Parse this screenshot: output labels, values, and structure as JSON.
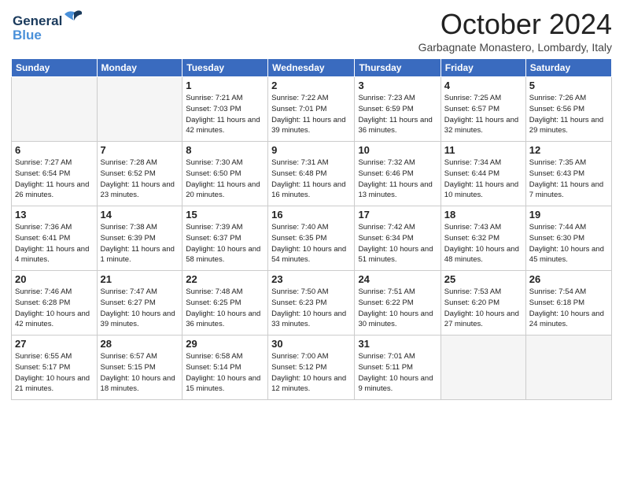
{
  "logo": {
    "line1": "General",
    "line2": "Blue"
  },
  "title": "October 2024",
  "subtitle": "Garbagnate Monastero, Lombardy, Italy",
  "days_of_week": [
    "Sunday",
    "Monday",
    "Tuesday",
    "Wednesday",
    "Thursday",
    "Friday",
    "Saturday"
  ],
  "weeks": [
    [
      {
        "day": "",
        "info": ""
      },
      {
        "day": "",
        "info": ""
      },
      {
        "day": "1",
        "info": "Sunrise: 7:21 AM\nSunset: 7:03 PM\nDaylight: 11 hours and 42 minutes."
      },
      {
        "day": "2",
        "info": "Sunrise: 7:22 AM\nSunset: 7:01 PM\nDaylight: 11 hours and 39 minutes."
      },
      {
        "day": "3",
        "info": "Sunrise: 7:23 AM\nSunset: 6:59 PM\nDaylight: 11 hours and 36 minutes."
      },
      {
        "day": "4",
        "info": "Sunrise: 7:25 AM\nSunset: 6:57 PM\nDaylight: 11 hours and 32 minutes."
      },
      {
        "day": "5",
        "info": "Sunrise: 7:26 AM\nSunset: 6:56 PM\nDaylight: 11 hours and 29 minutes."
      }
    ],
    [
      {
        "day": "6",
        "info": "Sunrise: 7:27 AM\nSunset: 6:54 PM\nDaylight: 11 hours and 26 minutes."
      },
      {
        "day": "7",
        "info": "Sunrise: 7:28 AM\nSunset: 6:52 PM\nDaylight: 11 hours and 23 minutes."
      },
      {
        "day": "8",
        "info": "Sunrise: 7:30 AM\nSunset: 6:50 PM\nDaylight: 11 hours and 20 minutes."
      },
      {
        "day": "9",
        "info": "Sunrise: 7:31 AM\nSunset: 6:48 PM\nDaylight: 11 hours and 16 minutes."
      },
      {
        "day": "10",
        "info": "Sunrise: 7:32 AM\nSunset: 6:46 PM\nDaylight: 11 hours and 13 minutes."
      },
      {
        "day": "11",
        "info": "Sunrise: 7:34 AM\nSunset: 6:44 PM\nDaylight: 11 hours and 10 minutes."
      },
      {
        "day": "12",
        "info": "Sunrise: 7:35 AM\nSunset: 6:43 PM\nDaylight: 11 hours and 7 minutes."
      }
    ],
    [
      {
        "day": "13",
        "info": "Sunrise: 7:36 AM\nSunset: 6:41 PM\nDaylight: 11 hours and 4 minutes."
      },
      {
        "day": "14",
        "info": "Sunrise: 7:38 AM\nSunset: 6:39 PM\nDaylight: 11 hours and 1 minute."
      },
      {
        "day": "15",
        "info": "Sunrise: 7:39 AM\nSunset: 6:37 PM\nDaylight: 10 hours and 58 minutes."
      },
      {
        "day": "16",
        "info": "Sunrise: 7:40 AM\nSunset: 6:35 PM\nDaylight: 10 hours and 54 minutes."
      },
      {
        "day": "17",
        "info": "Sunrise: 7:42 AM\nSunset: 6:34 PM\nDaylight: 10 hours and 51 minutes."
      },
      {
        "day": "18",
        "info": "Sunrise: 7:43 AM\nSunset: 6:32 PM\nDaylight: 10 hours and 48 minutes."
      },
      {
        "day": "19",
        "info": "Sunrise: 7:44 AM\nSunset: 6:30 PM\nDaylight: 10 hours and 45 minutes."
      }
    ],
    [
      {
        "day": "20",
        "info": "Sunrise: 7:46 AM\nSunset: 6:28 PM\nDaylight: 10 hours and 42 minutes."
      },
      {
        "day": "21",
        "info": "Sunrise: 7:47 AM\nSunset: 6:27 PM\nDaylight: 10 hours and 39 minutes."
      },
      {
        "day": "22",
        "info": "Sunrise: 7:48 AM\nSunset: 6:25 PM\nDaylight: 10 hours and 36 minutes."
      },
      {
        "day": "23",
        "info": "Sunrise: 7:50 AM\nSunset: 6:23 PM\nDaylight: 10 hours and 33 minutes."
      },
      {
        "day": "24",
        "info": "Sunrise: 7:51 AM\nSunset: 6:22 PM\nDaylight: 10 hours and 30 minutes."
      },
      {
        "day": "25",
        "info": "Sunrise: 7:53 AM\nSunset: 6:20 PM\nDaylight: 10 hours and 27 minutes."
      },
      {
        "day": "26",
        "info": "Sunrise: 7:54 AM\nSunset: 6:18 PM\nDaylight: 10 hours and 24 minutes."
      }
    ],
    [
      {
        "day": "27",
        "info": "Sunrise: 6:55 AM\nSunset: 5:17 PM\nDaylight: 10 hours and 21 minutes."
      },
      {
        "day": "28",
        "info": "Sunrise: 6:57 AM\nSunset: 5:15 PM\nDaylight: 10 hours and 18 minutes."
      },
      {
        "day": "29",
        "info": "Sunrise: 6:58 AM\nSunset: 5:14 PM\nDaylight: 10 hours and 15 minutes."
      },
      {
        "day": "30",
        "info": "Sunrise: 7:00 AM\nSunset: 5:12 PM\nDaylight: 10 hours and 12 minutes."
      },
      {
        "day": "31",
        "info": "Sunrise: 7:01 AM\nSunset: 5:11 PM\nDaylight: 10 hours and 9 minutes."
      },
      {
        "day": "",
        "info": ""
      },
      {
        "day": "",
        "info": ""
      }
    ]
  ]
}
